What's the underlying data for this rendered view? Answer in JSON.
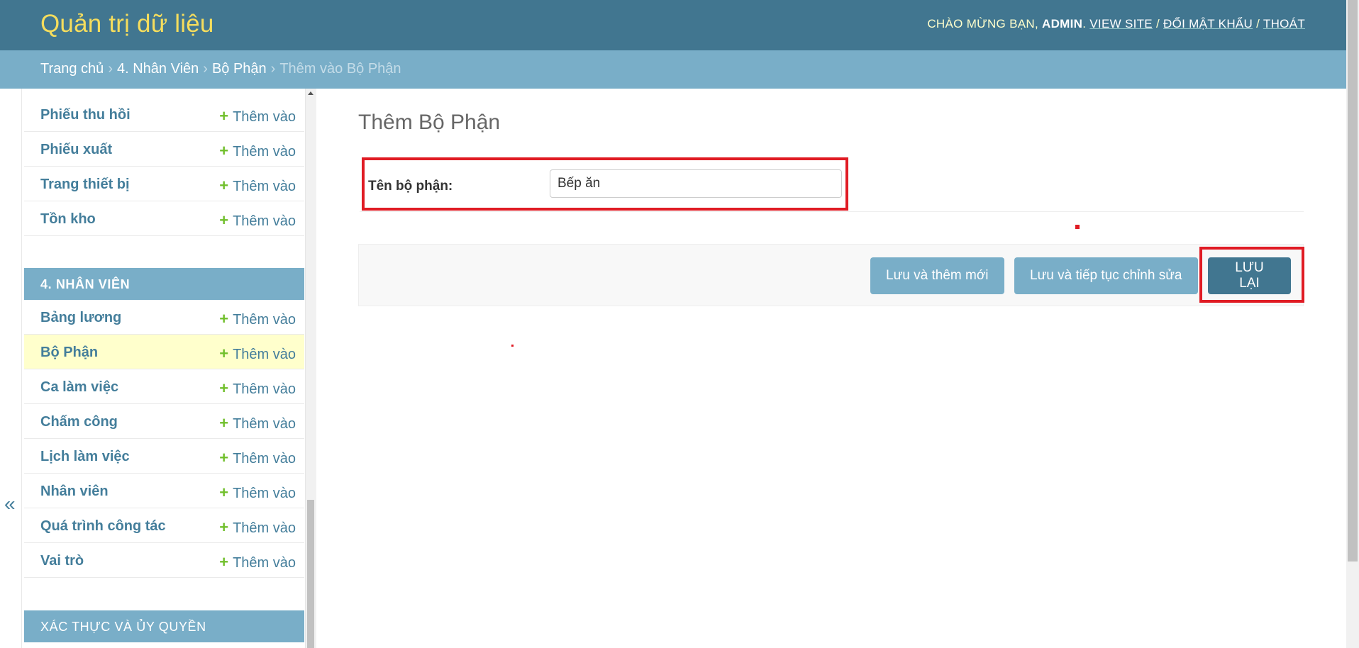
{
  "header": {
    "site_name": "Quản trị dữ liệu",
    "welcome": "Chào mừng bạn,",
    "username": "ADMIN",
    "view_site": "View site",
    "change_password": "Đổi mật khẩu",
    "logout": "Thoát",
    "separator": "/"
  },
  "breadcrumbs": {
    "home": "Trang chủ",
    "app": "4. Nhân Viên",
    "model": "Bộ Phận",
    "current": "Thêm vào Bộ Phận",
    "separator": "›"
  },
  "sidebar": {
    "collapse_icon": "double-chevron-left-icon",
    "collapse_glyph": "«",
    "add_label": "Thêm vào",
    "add_glyph": "+",
    "module_prev_items": [
      {
        "label": "Phiếu thu hồi"
      },
      {
        "label": "Phiếu xuất"
      },
      {
        "label": "Trang thiết bị"
      },
      {
        "label": "Tồn kho"
      }
    ],
    "module_nhanvien": {
      "caption": "4. Nhân Viên",
      "items": [
        {
          "label": "Bảng lương"
        },
        {
          "label": "Bộ Phận",
          "current": true
        },
        {
          "label": "Ca làm việc"
        },
        {
          "label": "Chấm công"
        },
        {
          "label": "Lịch làm việc"
        },
        {
          "label": "Nhân viên"
        },
        {
          "label": "Quá trình công tác"
        },
        {
          "label": "Vai trò"
        }
      ]
    },
    "module_auth": {
      "caption": "Xác thực và Ủy quyền"
    }
  },
  "content": {
    "title": "Thêm Bộ Phận",
    "field": {
      "label": "Tên bộ phận:",
      "value": "Bếp ăn"
    },
    "buttons": {
      "save_add": "Lưu và thêm mới",
      "save_continue": "Lưu và tiếp tục chỉnh sửa",
      "save": "Lưu lại"
    }
  },
  "colors": {
    "header_bg": "#417690",
    "breadcrumb_bg": "#79aec8",
    "link": "#447e9b",
    "add_plus": "#70bf2b",
    "current_row": "#ffffcc",
    "annotation_red": "#e01b24"
  }
}
